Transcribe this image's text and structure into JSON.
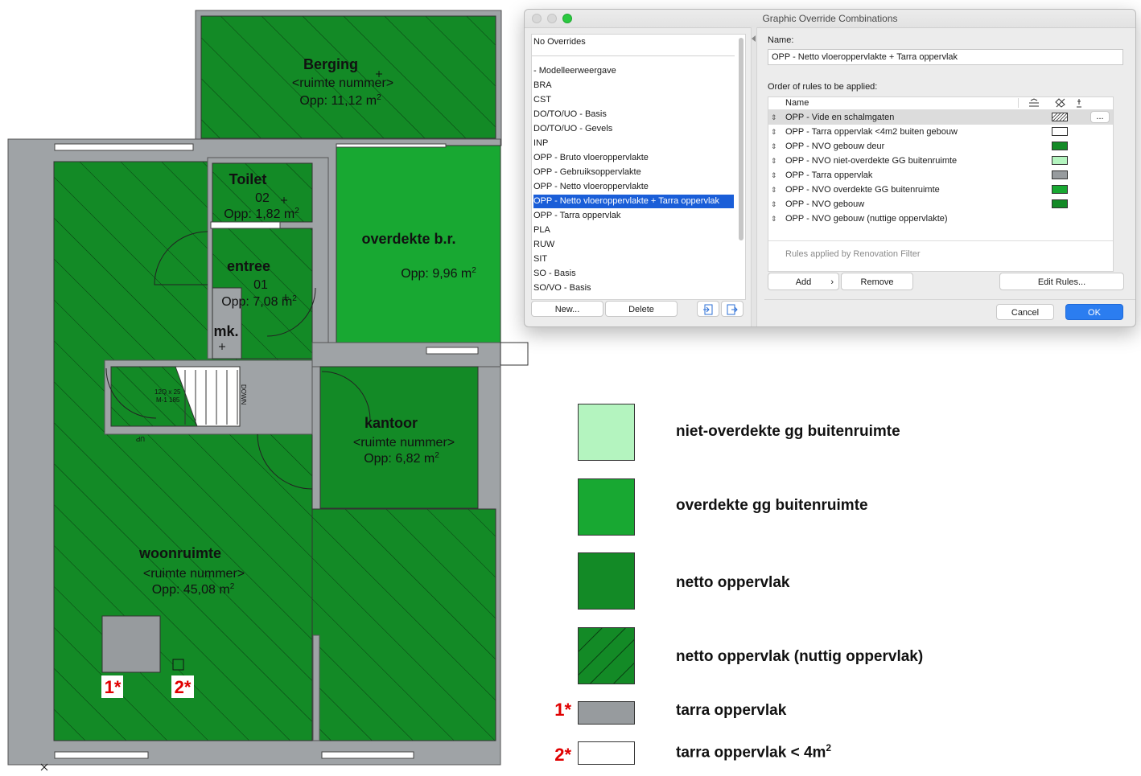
{
  "floorplan": {
    "rooms": [
      {
        "name": "Berging",
        "number": "<ruimte nummer>",
        "area": "Opp: 11,12 m",
        "unit_sup": "2"
      },
      {
        "name": "Toilet",
        "number": "02",
        "area": "Opp: 1,82 m",
        "unit_sup": "2"
      },
      {
        "name": "entree",
        "number": "01",
        "area": "Opp: 7,08 m",
        "unit_sup": "2"
      },
      {
        "name": "overdekte b.r.",
        "number": "",
        "area": "Opp: 9,96 m",
        "unit_sup": "2"
      },
      {
        "name": "mk.",
        "number": "",
        "area": "",
        "unit_sup": ""
      },
      {
        "name": "kantoor",
        "number": "<ruimte nummer>",
        "area": "Opp: 6,82 m",
        "unit_sup": "2"
      },
      {
        "name": "woonruimte",
        "number": "<ruimte nummer>",
        "area": "Opp: 45,08 m",
        "unit_sup": "2"
      }
    ],
    "stair_labels": {
      "down": "DOWN",
      "up": "UP",
      "dims": "12Q x 25",
      "dims2": "M-1 185"
    },
    "markers": [
      "1*",
      "2*"
    ],
    "colors": {
      "netto": "#138a26",
      "netto_dark": "#0f7a20",
      "overdekte": "#18a832",
      "niet_overdekte": "#b4f4bf",
      "tarra": "#979b9e",
      "wall": "#9fa3a6"
    }
  },
  "dialog": {
    "title": "Graphic Override Combinations",
    "list": {
      "items": [
        "No Overrides",
        "- Modelleerweergave",
        "BRA",
        "CST",
        "DO/TO/UO - Basis",
        "DO/TO/UO - Gevels",
        "INP",
        "OPP - Bruto vloeroppervlakte",
        "OPP - Gebruiksoppervlakte",
        "OPP - Netto vloeroppervlakte",
        "OPP - Netto vloeroppervlakte + Tarra oppervlak",
        "OPP - Tarra oppervlak",
        "PLA",
        "RUW",
        "SIT",
        "SO - Basis",
        "SO/VO - Basis"
      ],
      "selected": "OPP - Netto vloeroppervlakte + Tarra oppervlak",
      "new_label": "New...",
      "delete_label": "Delete"
    },
    "name_label": "Name:",
    "name_value": "OPP - Netto vloeroppervlakte + Tarra oppervlak",
    "order_label": "Order of rules to be applied:",
    "col_name": "Name",
    "rules": [
      {
        "name": "OPP - Vide en schalmgaten",
        "swatch": "hatch"
      },
      {
        "name": "OPP - Tarra oppervlak <4m2 buiten gebouw",
        "swatch": "#ffffff"
      },
      {
        "name": "OPP - NVO gebouw deur",
        "swatch": "#138a26"
      },
      {
        "name": "OPP - NVO niet-overdekte GG buitenruimte",
        "swatch": "#b4f4bf"
      },
      {
        "name": "OPP - Tarra oppervlak",
        "swatch": "#979b9e"
      },
      {
        "name": "OPP - NVO overdekte GG buitenruimte",
        "swatch": "#18a832"
      },
      {
        "name": "OPP - NVO gebouw",
        "swatch": "#138a26"
      },
      {
        "name": "OPP - NVO gebouw (nuttige oppervlakte)",
        "swatch": ""
      }
    ],
    "more_button": "...",
    "renovation_text": "Rules applied by Renovation Filter",
    "add_label": "Add",
    "remove_label": "Remove",
    "edit_rules_label": "Edit Rules...",
    "cancel_label": "Cancel",
    "ok_label": "OK"
  },
  "legend": {
    "items": [
      {
        "label": "niet-overdekte gg buitenruimte",
        "color": "#b4f4bf",
        "pattern": "solid"
      },
      {
        "label": "overdekte gg buitenruimte",
        "color": "#18a832",
        "pattern": "solid"
      },
      {
        "label": "netto oppervlak",
        "color": "#138a26",
        "pattern": "solid"
      },
      {
        "label": "netto oppervlak (nuttig oppervlak)",
        "color": "#138a26",
        "pattern": "hatch"
      },
      {
        "label": "tarra oppervlak",
        "marker": "1*",
        "color": "#979b9e"
      },
      {
        "label": "tarra oppervlak < 4m",
        "label_sup": "2",
        "marker": "2*",
        "color": "#ffffff"
      }
    ]
  }
}
